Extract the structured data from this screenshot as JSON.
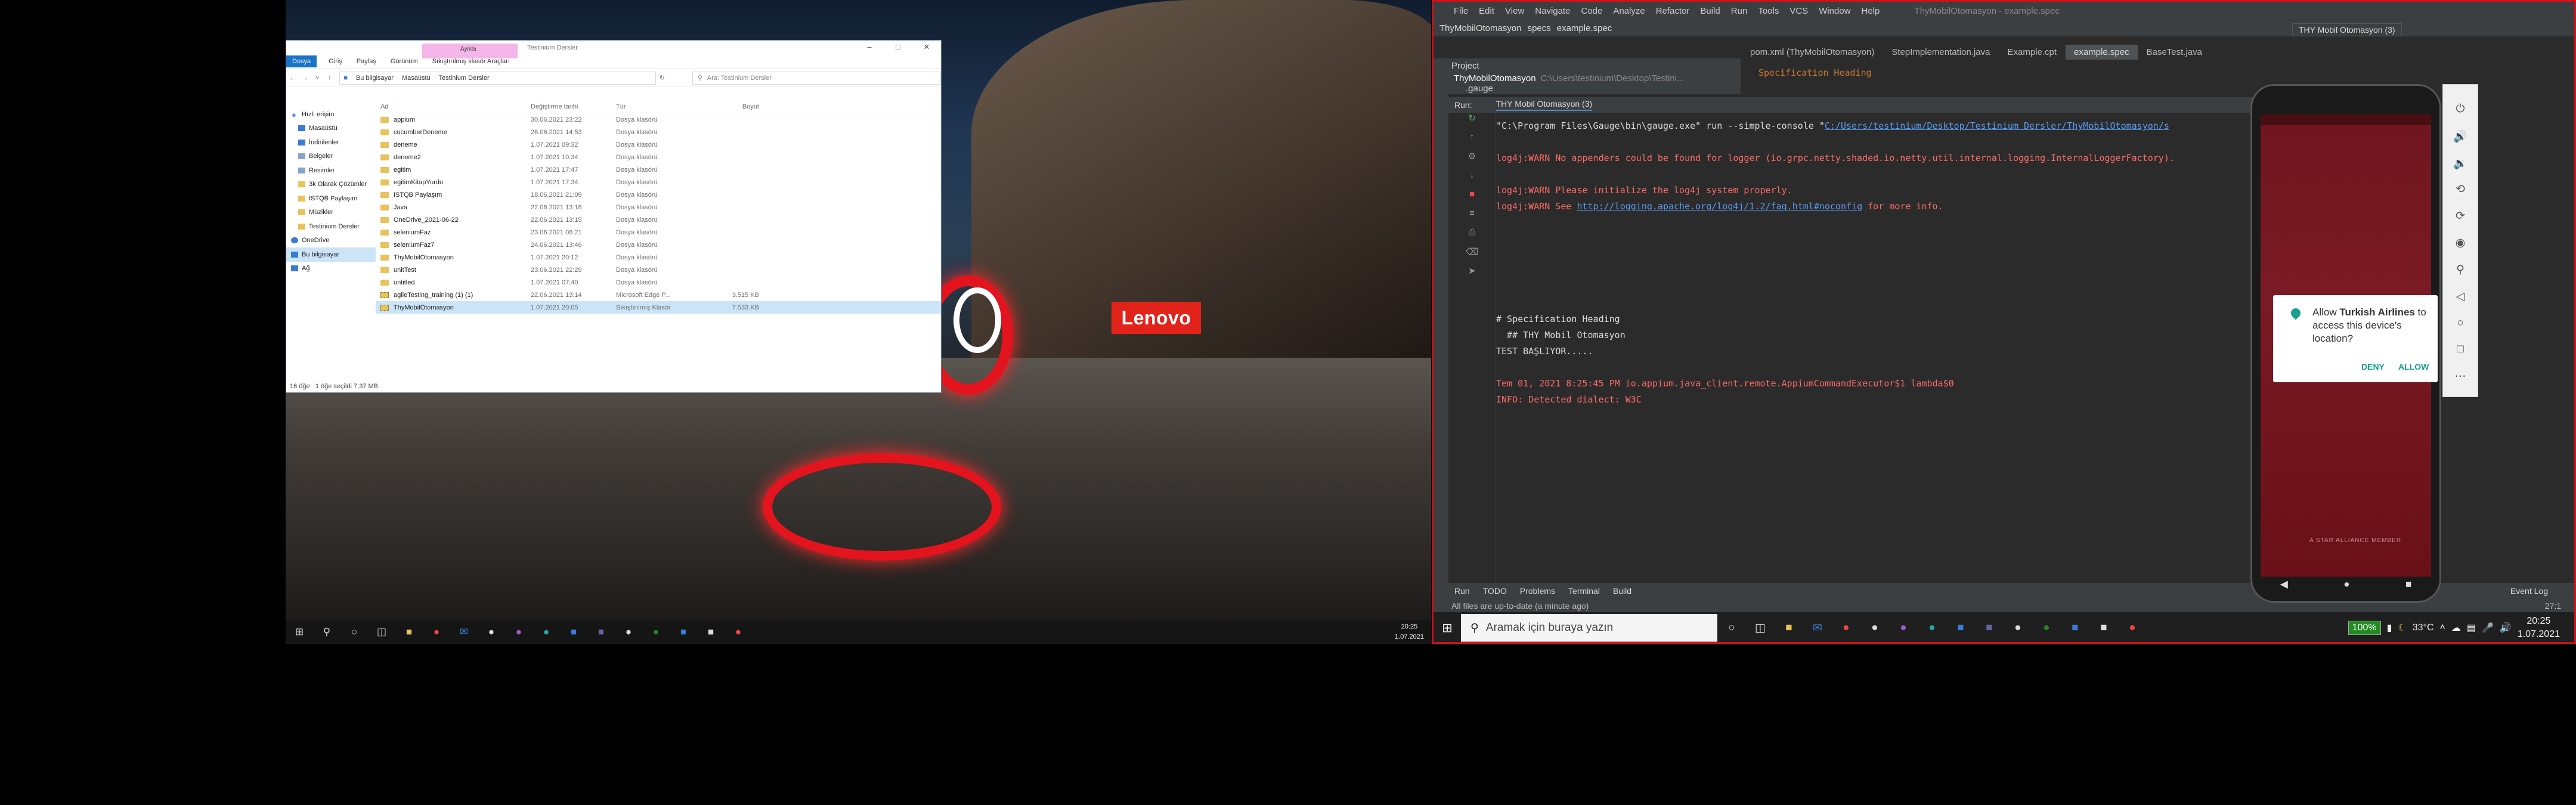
{
  "explorer": {
    "ribbon_context_tab": "Ayikla",
    "window_title": "Testinium Dersler",
    "ribbon_tabs": [
      "Dosya",
      "Giriş",
      "Paylaş",
      "Görünüm",
      "Sıkıştırılmış klasör Araçları"
    ],
    "path": [
      "Bu bilgisayar",
      "Masaüstü",
      "Testinium Dersler"
    ],
    "search_placeholder": "Ara: Testinium Dersler",
    "nav": [
      "Hızlı erişim",
      "Masaüstü",
      "İndirilenler",
      "Belgeler",
      "Resimler",
      "3k Olarak Çözümler",
      "ISTQB Paylaşım",
      "Müzikler",
      "Testinium Dersler",
      "OneDrive",
      "Bu bilgisayar",
      "Ağ"
    ],
    "columns": [
      "Ad",
      "Değiştirme tarihi",
      "Tür",
      "Boyut"
    ],
    "rows": [
      {
        "name": "appium",
        "date": "30.06.2021 23:22",
        "type": "Dosya klasörü",
        "size": ""
      },
      {
        "name": "cucumberDeneme",
        "date": "26.06.2021 14:53",
        "type": "Dosya klasörü",
        "size": ""
      },
      {
        "name": "deneme",
        "date": "1.07.2021 09:32",
        "type": "Dosya klasörü",
        "size": ""
      },
      {
        "name": "deneme2",
        "date": "1.07.2021 10:34",
        "type": "Dosya klasörü",
        "size": ""
      },
      {
        "name": "egitim",
        "date": "1.07.2021 17:47",
        "type": "Dosya klasörü",
        "size": ""
      },
      {
        "name": "egitimKitapYurdu",
        "date": "1.07.2021 17:34",
        "type": "Dosya klasörü",
        "size": ""
      },
      {
        "name": "ISTQB Paylaşım",
        "date": "18.06.2021 21:09",
        "type": "Dosya klasörü",
        "size": ""
      },
      {
        "name": "Java",
        "date": "22.06.2021 13:18",
        "type": "Dosya klasörü",
        "size": ""
      },
      {
        "name": "OneDrive_2021-06-22",
        "date": "22.06.2021 13:15",
        "type": "Dosya klasörü",
        "size": ""
      },
      {
        "name": "seleniumFaz",
        "date": "23.06.2021 08:21",
        "type": "Dosya klasörü",
        "size": ""
      },
      {
        "name": "seleniumFaz7",
        "date": "24.06.2021 13:46",
        "type": "Dosya klasörü",
        "size": ""
      },
      {
        "name": "ThyMobilOtomasyon",
        "date": "1.07.2021 20:12",
        "type": "Dosya klasörü",
        "size": ""
      },
      {
        "name": "unitTest",
        "date": "23.06.2021 22:29",
        "type": "Dosya klasörü",
        "size": ""
      },
      {
        "name": "untitled",
        "date": "1.07.2021 07:40",
        "type": "Dosya klasörü",
        "size": ""
      },
      {
        "name": "agileTesting_training (1) (1)",
        "date": "22.06.2021 13:14",
        "type": "Microsoft Edge P...",
        "size": "3.515 KB"
      },
      {
        "name": "ThyMobilOtomasyon",
        "date": "1.07.2021 20:05",
        "type": "Sıkıştırılmış Klasör",
        "size": "7.533 KB"
      }
    ],
    "status": "1 öğe seçildi  7,37 MB",
    "status_count": "16 öğe"
  },
  "wallpaper_brand": "Lenovo",
  "taskbar1": {
    "time": "20:25",
    "date": "1.07.2021"
  },
  "ide": {
    "menu": [
      "File",
      "Edit",
      "View",
      "Navigate",
      "Code",
      "Analyze",
      "Refactor",
      "Build",
      "Run",
      "Tools",
      "VCS",
      "Window",
      "Help"
    ],
    "title": "ThyMobilOtomasyon - example.spec",
    "breadcrumb": [
      "ThyMobilOtomasyon",
      "specs",
      "example.spec"
    ],
    "run_config": "THY Mobil Otomasyon (3)",
    "tabs": [
      "pom.xml (ThyMobilOtomasyon)",
      "StepImplementation.java",
      "Example.cpt",
      "example.spec",
      "BaseTest.java"
    ],
    "active_tab": "example.spec",
    "project_label": "Project",
    "project_root": "ThyMobilOtomasyon",
    "project_root_path": "C:\\Users\\testinium\\Desktop\\Testini...",
    "project_child": ".gauge",
    "editor_line": "Specification Heading",
    "run_label": "Run:",
    "run_tab": "THY Mobil Otomasyon (3)",
    "console": {
      "cmd_prefix": "\"C:\\Program Files\\Gauge\\bin\\gauge.exe\" run --simple-console \"",
      "cmd_link": "C:/Users/testinium/Desktop/Testinium Dersler/ThyMobilOtomasyon/s",
      "warn1": "log4j:WARN No appenders could be found for logger (io.grpc.netty.shaded.io.netty.util.internal.logging.InternalLoggerFactory).",
      "warn2": "log4j:WARN Please initialize the log4j system properly.",
      "warn3_prefix": "log4j:WARN See ",
      "warn3_link": "http://logging.apache.org/log4j/1.2/faq.html#noconfig",
      "warn3_suffix": " for more info.",
      "spec1": "# Specification Heading",
      "spec2": "  ## THY Mobil Otomasyon",
      "spec3": "TEST BAŞLIYOR.....",
      "red1": "Tem 01, 2021 8:25:45 PM io.appium.java_client.remote.AppiumCommandExecutor$1 lambda$0",
      "red2": "INFO: Detected dialect: W3C"
    },
    "bottom_tabs": [
      "Run",
      "TODO",
      "Problems",
      "Terminal",
      "Build"
    ],
    "event_log": "Event Log",
    "status": "All files are up-to-date (a minute ago)",
    "caret": "27:1"
  },
  "phone": {
    "dialog_prefix": "Allow ",
    "dialog_app": "Turkish Airlines",
    "dialog_suffix": " to access this device's location?",
    "deny": "DENY",
    "allow": "ALLOW",
    "alliance": "A STAR ALLIANCE MEMBER"
  },
  "taskbar2": {
    "search_placeholder": "Aramak için buraya yazın",
    "battery": "100%",
    "temperature": "33°C",
    "time": "20:25",
    "date": "1.07.2021"
  }
}
